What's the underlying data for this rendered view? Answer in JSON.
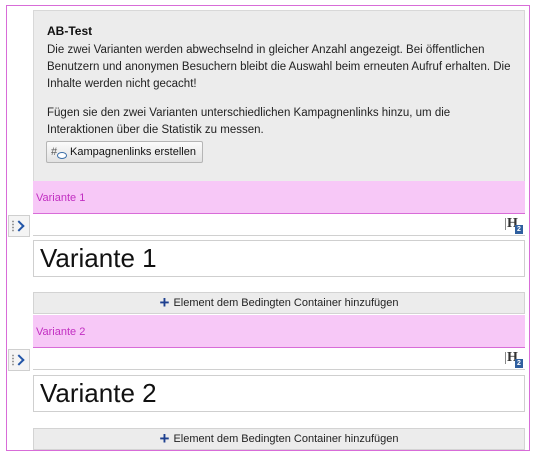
{
  "ab_test": {
    "title": "AB-Test",
    "description": "Die zwei Varianten werden abwechselnd in gleicher Anzahl angezeigt. Bei öffentlichen Benutzern und anonymen Besuchern bleibt die Auswahl beim erneuten Aufruf erhalten. Die Inhalte werden nicht gecacht!",
    "hint": "Fügen sie den zwei Varianten unterschiedlichen Kampagnenlinks hinzu, um die Interaktionen über die Statistik zu messen.",
    "campaign_button": "Kampagnenlinks erstellen",
    "campaign_icon": "#"
  },
  "variants": [
    {
      "header": "Variante 1",
      "heading_text": "Variante 1",
      "heading_badge": "2",
      "add_button": "Element dem Bedingten Container hinzufügen"
    },
    {
      "header": "Variante 2",
      "heading_text": "Variante 2",
      "heading_badge": "2",
      "add_button": "Element dem Bedingten Container hinzufügen"
    }
  ],
  "icons": {
    "heading": "H",
    "add": "+"
  },
  "colors": {
    "variant_header_bg": "#f7c8f7",
    "variant_header_text": "#c22fc2",
    "frame_border": "#d86cd8",
    "info_bg": "#ececec",
    "add_icon": "#1d3f8f"
  }
}
